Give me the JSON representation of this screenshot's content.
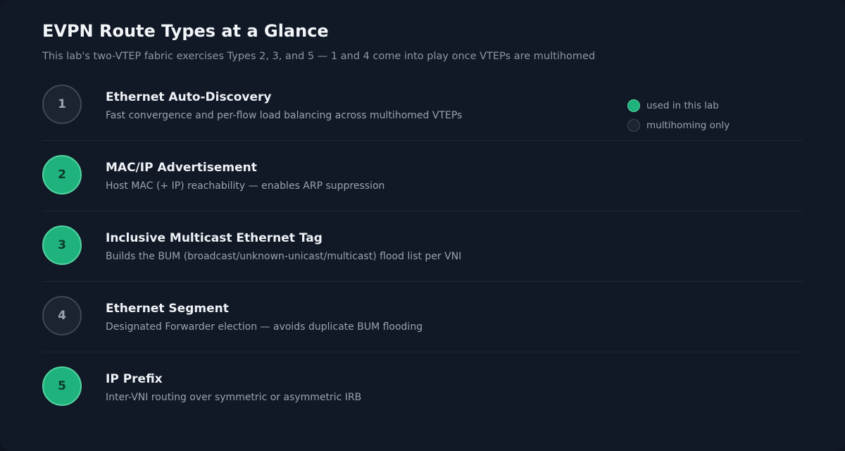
{
  "title": "EVPN Route Types at a Glance",
  "subtitle": "This lab's two-VTEP fabric exercises Types 2, 3, and 5 — 1 and 4 come into play once VTEPs are multihomed",
  "routes": [
    {
      "number": "1",
      "name": "Ethernet Auto-Discovery",
      "description": "Fast convergence and per-flow load balancing across multihomed VTEPs",
      "used_in_lab": false
    },
    {
      "number": "2",
      "name": "MAC/IP Advertisement",
      "description": "Host MAC (+ IP) reachability — enables ARP suppression",
      "used_in_lab": true
    },
    {
      "number": "3",
      "name": "Inclusive Multicast Ethernet Tag",
      "description": "Builds the BUM (broadcast/unknown-unicast/multicast) flood list per VNI",
      "used_in_lab": true
    },
    {
      "number": "4",
      "name": "Ethernet Segment",
      "description": "Designated Forwarder election — avoids duplicate BUM flooding",
      "used_in_lab": false
    },
    {
      "number": "5",
      "name": "IP Prefix",
      "description": "Inter-VNI routing over symmetric or asymmetric IRB",
      "used_in_lab": true
    }
  ],
  "legend": {
    "used": "used in this lab",
    "multihoming": "multihoming only"
  },
  "colors": {
    "accent": "#1fb27d",
    "accent_border": "#53d4a1",
    "inactive_fill": "#1c2432",
    "inactive_border": "#3d4858",
    "background": "#111826"
  }
}
